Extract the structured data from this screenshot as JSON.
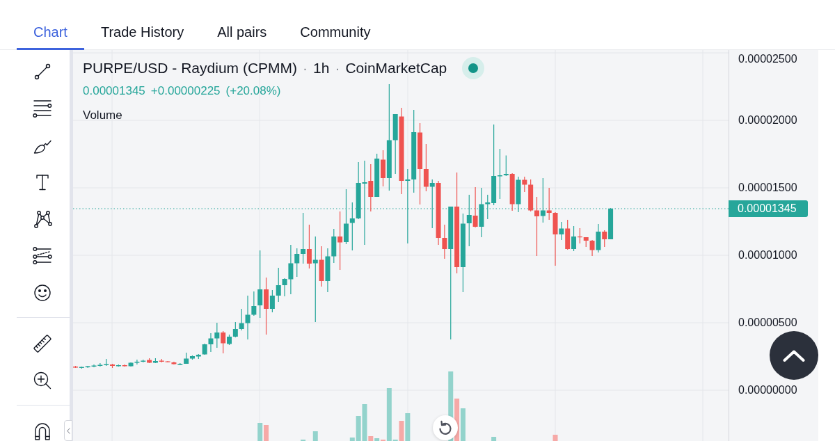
{
  "tabs": [
    {
      "label": "Chart",
      "selected": true
    },
    {
      "label": "Trade History",
      "selected": false
    },
    {
      "label": "All pairs",
      "selected": false
    },
    {
      "label": "Community",
      "selected": false
    }
  ],
  "chart": {
    "legend": {
      "title_parts": [
        {
          "text": "PURPE/USD - Raydium (CPMM)"
        },
        {
          "separator": "·",
          "text": "1h"
        },
        {
          "separator": "·",
          "text": "CoinMarketCap"
        }
      ]
    },
    "quote": {
      "last": "0.00001345",
      "change": "+0.00000225",
      "change_percent": "(+20.08%)"
    },
    "volume_label": "Volume"
  },
  "price_axis": {
    "ticks": [
      "0.00002500",
      "0.00002000",
      "0.00001500",
      "0.00001000",
      "0.00000500",
      "0.00000000"
    ],
    "last_price": "0.00001345"
  }
}
